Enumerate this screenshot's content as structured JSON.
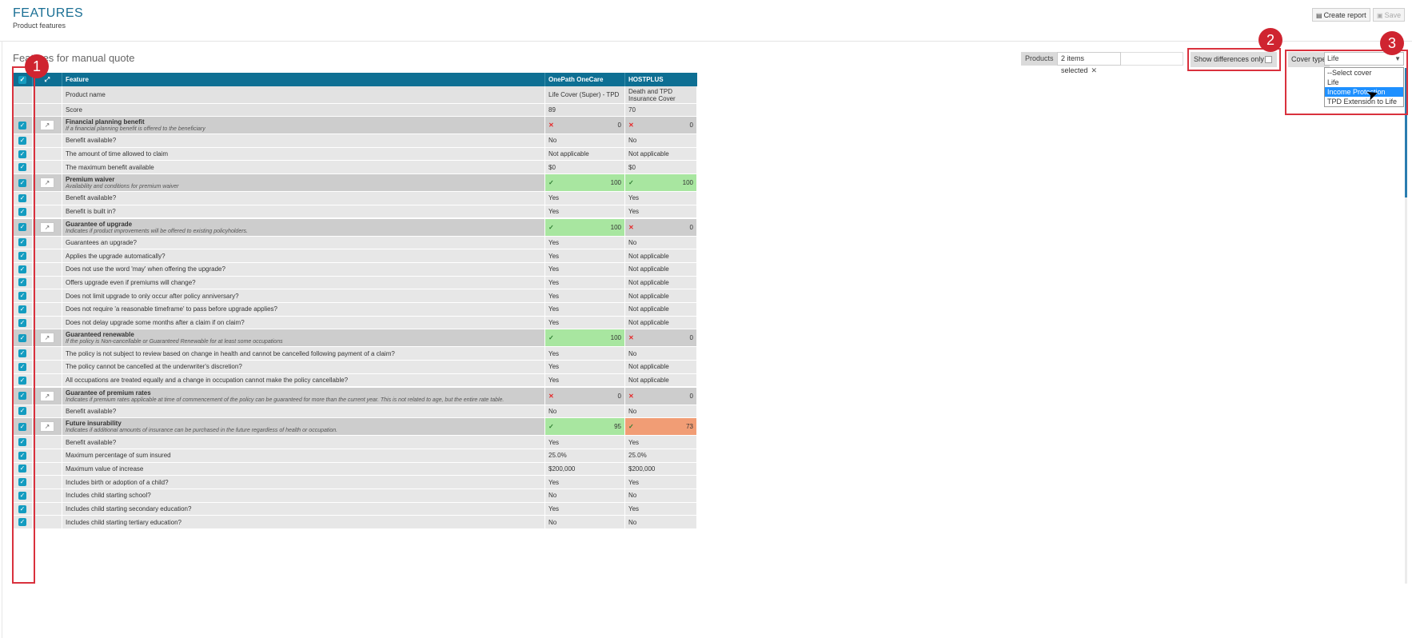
{
  "header": {
    "title": "FEATURES",
    "subtitle": "Product features",
    "create_report_label": "Create report",
    "save_label": "Save"
  },
  "section_title": "Features for manual quote",
  "filters": {
    "products_label": "Products",
    "products_value": "2 items selected",
    "show_differences_label": "Show differences only",
    "show_differences_checked": false,
    "cover_type_label": "Cover type",
    "cover_type_value": "Life",
    "cover_options": [
      "--Select cover",
      "Life",
      "Income Protection",
      "TPD Extension to Life"
    ],
    "cover_highlighted": "Income Protection"
  },
  "annotations": [
    "1",
    "2",
    "3"
  ],
  "table": {
    "columns": [
      "Feature",
      "OnePath OneCare",
      "HOSTPLUS"
    ],
    "product_name_label": "Product name",
    "product_names": [
      "Life Cover (Super) - TPD",
      "Death and TPD Insurance Cover"
    ],
    "score_label": "Score",
    "scores": [
      "89",
      "70"
    ],
    "rows": [
      {
        "type": "group",
        "name": "Financial planning benefit",
        "desc": "If a financial planning benefit is offered to the beneficiary",
        "a": {
          "mark": "x",
          "score": "0",
          "color": ""
        },
        "b": {
          "mark": "x",
          "score": "0",
          "color": ""
        }
      },
      {
        "type": "detail",
        "name": "Benefit available?",
        "a": "No",
        "b": "No"
      },
      {
        "type": "detail",
        "name": "The amount of time allowed to claim",
        "a": "Not applicable",
        "b": "Not applicable"
      },
      {
        "type": "detail",
        "name": "The maximum benefit available",
        "a": "$0",
        "b": "$0"
      },
      {
        "type": "group",
        "name": "Premium waiver",
        "desc": "Availability and conditions for premium waiver",
        "a": {
          "mark": "check",
          "score": "100",
          "color": "green"
        },
        "b": {
          "mark": "check",
          "score": "100",
          "color": "green"
        }
      },
      {
        "type": "detail",
        "name": "Benefit available?",
        "a": "Yes",
        "b": "Yes"
      },
      {
        "type": "detail",
        "name": "Benefit is built in?",
        "a": "Yes",
        "b": "Yes"
      },
      {
        "type": "group",
        "name": "Guarantee of upgrade",
        "desc": "Indicates if product improvements will be offered to existing policyholders.",
        "a": {
          "mark": "check",
          "score": "100",
          "color": "green"
        },
        "b": {
          "mark": "x",
          "score": "0",
          "color": ""
        }
      },
      {
        "type": "detail",
        "name": "Guarantees an upgrade?",
        "a": "Yes",
        "b": "No"
      },
      {
        "type": "detail",
        "name": "Applies the upgrade automatically?",
        "a": "Yes",
        "b": "Not applicable"
      },
      {
        "type": "detail",
        "name": "Does not use the word 'may' when offering the upgrade?",
        "a": "Yes",
        "b": "Not applicable"
      },
      {
        "type": "detail",
        "name": "Offers upgrade even if premiums will change?",
        "a": "Yes",
        "b": "Not applicable"
      },
      {
        "type": "detail",
        "name": "Does not limit upgrade to only occur after policy anniversary?",
        "a": "Yes",
        "b": "Not applicable"
      },
      {
        "type": "detail",
        "name": "Does not require 'a reasonable timeframe' to pass before upgrade applies?",
        "a": "Yes",
        "b": "Not applicable"
      },
      {
        "type": "detail",
        "name": "Does not delay upgrade some months after a claim if on claim?",
        "a": "Yes",
        "b": "Not applicable"
      },
      {
        "type": "group",
        "name": "Guaranteed renewable",
        "desc": "If the policy is Non-cancellable or Guaranteed Renewable for at least some occupations",
        "a": {
          "mark": "check",
          "score": "100",
          "color": "green"
        },
        "b": {
          "mark": "x",
          "score": "0",
          "color": ""
        }
      },
      {
        "type": "detail",
        "name": "The policy is not subject to review based on change in health and cannot be cancelled following payment of a claim?",
        "a": "Yes",
        "b": "No"
      },
      {
        "type": "detail",
        "name": "The policy cannot be cancelled at the underwriter's discretion?",
        "a": "Yes",
        "b": "Not applicable"
      },
      {
        "type": "detail",
        "name": "All occupations are treated equally and a change in occupation cannot make the policy cancellable?",
        "a": "Yes",
        "b": "Not applicable"
      },
      {
        "type": "group",
        "name": "Guarantee of premium rates",
        "desc": "Indicates if premium rates applicable at time of commencement of the policy can be guaranteed for more than the current year. This is not related to age, but the entire rate table.",
        "a": {
          "mark": "x",
          "score": "0",
          "color": ""
        },
        "b": {
          "mark": "x",
          "score": "0",
          "color": ""
        }
      },
      {
        "type": "detail",
        "name": "Benefit available?",
        "a": "No",
        "b": "No"
      },
      {
        "type": "group",
        "name": "Future insurability",
        "desc": "Indicates if additional amounts of insurance can be purchased in the future regardless of health or occupation.",
        "a": {
          "mark": "check",
          "score": "95",
          "color": "green"
        },
        "b": {
          "mark": "check",
          "score": "73",
          "color": "orange"
        }
      },
      {
        "type": "detail",
        "name": "Benefit available?",
        "a": "Yes",
        "b": "Yes"
      },
      {
        "type": "detail",
        "name": "Maximum percentage of sum insured",
        "a": "25.0%",
        "b": "25.0%"
      },
      {
        "type": "detail",
        "name": "Maximum value of increase",
        "a": "$200,000",
        "b": "$200,000"
      },
      {
        "type": "detail",
        "name": "Includes birth or adoption of a child?",
        "a": "Yes",
        "b": "Yes"
      },
      {
        "type": "detail",
        "name": "Includes child starting school?",
        "a": "No",
        "b": "No"
      },
      {
        "type": "detail",
        "name": "Includes child starting secondary education?",
        "a": "Yes",
        "b": "Yes"
      },
      {
        "type": "detail",
        "name": "Includes child starting tertiary education?",
        "a": "No",
        "b": "No"
      }
    ]
  },
  "colors": {
    "header_teal": "#0e6f93",
    "checkbox_blue": "#149cc0",
    "score_green": "#a8e6a0",
    "score_orange": "#f19d75",
    "annotation_red": "#cf2430"
  }
}
